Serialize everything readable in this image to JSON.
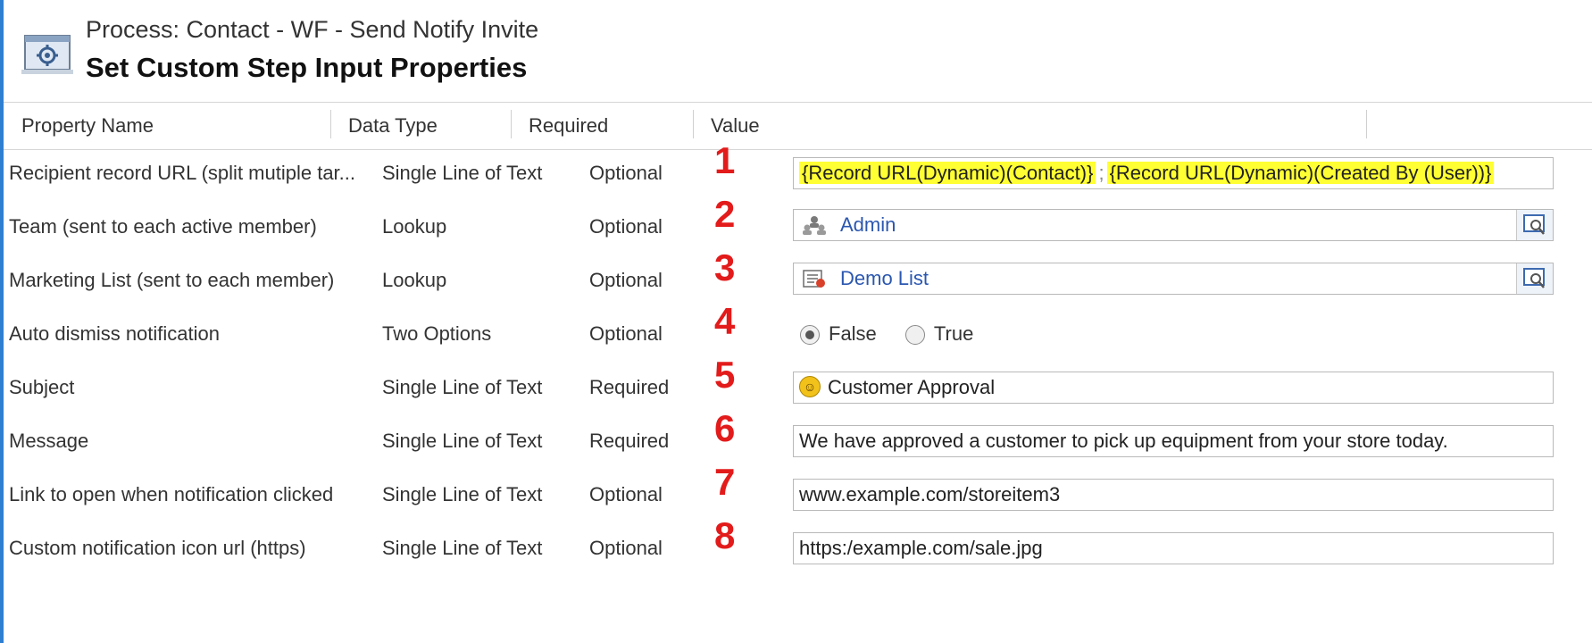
{
  "header": {
    "process_line": "Process: Contact - WF - Send Notify Invite",
    "title": "Set Custom Step Input Properties",
    "icon": "process-settings-icon"
  },
  "columns": {
    "property_name": "Property Name",
    "data_type": "Data Type",
    "required": "Required",
    "value": "Value"
  },
  "rows": [
    {
      "name": "Recipient record URL (split mutiple tar...",
      "type": "Single Line of Text",
      "required": "Optional",
      "marker": "1",
      "value_part1": "{Record URL(Dynamic)(Contact)}",
      "separator": ";",
      "value_part2": "{Record URL(Dynamic)(Created By (User))}"
    },
    {
      "name": "Team (sent to each active member)",
      "type": "Lookup",
      "required": "Optional",
      "marker": "2",
      "value": "Admin",
      "icon": "team-icon"
    },
    {
      "name": "Marketing List (sent to each member)",
      "type": "Lookup",
      "required": "Optional",
      "marker": "3",
      "value": "Demo List",
      "icon": "marketing-list-icon"
    },
    {
      "name": "Auto dismiss notification",
      "type": "Two Options",
      "required": "Optional",
      "marker": "4",
      "option_false": "False",
      "option_true": "True",
      "selected": "False"
    },
    {
      "name": "Subject",
      "type": "Single Line of Text",
      "required": "Required",
      "marker": "5",
      "value": "Customer Approval",
      "icon": "emoji-icon"
    },
    {
      "name": "Message",
      "type": "Single Line of Text",
      "required": "Required",
      "marker": "6",
      "value": "We have approved a customer to pick up equipment from your store today."
    },
    {
      "name": "Link to open when notification clicked",
      "type": "Single Line of Text",
      "required": "Optional",
      "marker": "7",
      "value": "www.example.com/storeitem3"
    },
    {
      "name": "Custom notification icon url (https)",
      "type": "Single Line of Text",
      "required": "Optional",
      "marker": "8",
      "value": "https:/example.com/sale.jpg"
    }
  ],
  "colors": {
    "highlight": "#ffff33",
    "marker": "#e31b1b",
    "link": "#2b57b0",
    "accent_edge": "#2f7fd1"
  }
}
